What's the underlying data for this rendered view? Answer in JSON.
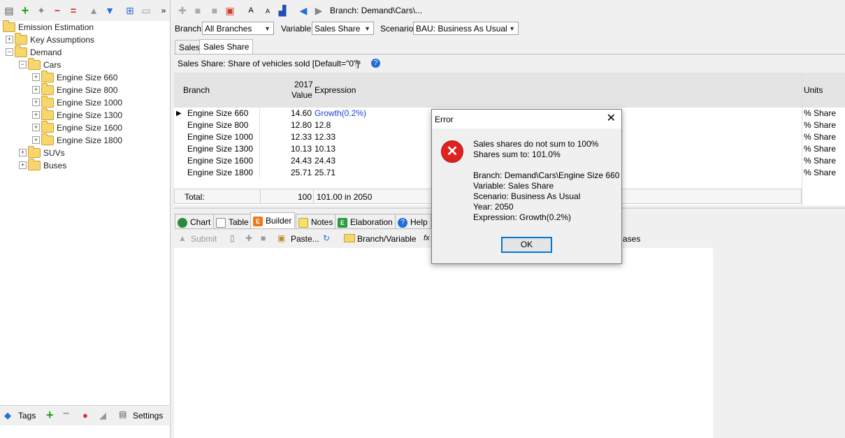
{
  "left_toolbar": {
    "icons": [
      "properties-icon",
      "add-icon",
      "add-many-icon",
      "delete-icon",
      "delete-many-icon",
      "move-up-icon",
      "move-down-icon",
      "tree-view-icon",
      "folder-icon",
      "more-icon"
    ],
    "more": "»"
  },
  "tree": [
    {
      "label": "Emission Estimation",
      "level": 0,
      "expander": ""
    },
    {
      "label": "Key Assumptions",
      "level": 1,
      "expander": "+"
    },
    {
      "label": "Demand",
      "level": 1,
      "expander": "−"
    },
    {
      "label": "Cars",
      "level": 2,
      "expander": "−"
    },
    {
      "label": "Engine Size 660",
      "level": 3,
      "expander": "+"
    },
    {
      "label": "Engine Size 800",
      "level": 3,
      "expander": "+"
    },
    {
      "label": "Engine Size 1000",
      "level": 3,
      "expander": "+"
    },
    {
      "label": "Engine Size 1300",
      "level": 3,
      "expander": "+"
    },
    {
      "label": "Engine Size 1600",
      "level": 3,
      "expander": "+"
    },
    {
      "label": "Engine Size 1800",
      "level": 3,
      "expander": "+"
    },
    {
      "label": "SUVs",
      "level": 2,
      "expander": "+"
    },
    {
      "label": "Buses",
      "level": 2,
      "expander": "+"
    }
  ],
  "left_bottom": {
    "tags": "Tags",
    "settings": "Settings"
  },
  "toolbar": {
    "breadcrumb": "Branch: Demand\\Cars\\...",
    "font_big": "A",
    "font_small": "A"
  },
  "filters": {
    "branch_label": "Branch:",
    "branch_value": "All Branches",
    "variable_label": "Variable:",
    "variable_value": "Sales Share",
    "scenario_label": "Scenario:",
    "scenario_value": "BAU: Business As Usual"
  },
  "tabs": [
    {
      "label": "Sales"
    },
    {
      "label": "Sales Share"
    }
  ],
  "description": "Sales Share: Share of vehicles sold [Default=\"0\"]",
  "grid": {
    "headers": {
      "branch": "Branch",
      "year": "2017",
      "value": "Value",
      "expression": "Expression",
      "units": "Units"
    },
    "rows": [
      {
        "branch": "Engine Size 660",
        "value": "14.60",
        "expression": "Growth(0.2%)",
        "units": "% Share"
      },
      {
        "branch": "Engine Size 800",
        "value": "12.80",
        "expression": "12.8",
        "units": "% Share"
      },
      {
        "branch": "Engine Size 1000",
        "value": "12.33",
        "expression": "12.33",
        "units": "% Share"
      },
      {
        "branch": "Engine Size 1300",
        "value": "10.13",
        "expression": "10.13",
        "units": "% Share"
      },
      {
        "branch": "Engine Size 1600",
        "value": "24.43",
        "expression": "24.43",
        "units": "% Share"
      },
      {
        "branch": "Engine Size 1800",
        "value": "25.71",
        "expression": "25.71",
        "units": "% Share"
      }
    ],
    "total": {
      "label": "Total:",
      "value": "100",
      "expression": "101.00 in 2050"
    }
  },
  "bottom_tabs": [
    {
      "label": "Chart"
    },
    {
      "label": "Table"
    },
    {
      "label": "Builder"
    },
    {
      "label": "Notes"
    },
    {
      "label": "Elaboration"
    },
    {
      "label": "Help"
    }
  ],
  "builder": {
    "submit": "Submit",
    "paste": "Paste...",
    "branch_variable": "Branch/Variable",
    "fx": "fx",
    "bases_fragment": "ases"
  },
  "dialog": {
    "title": "Error",
    "line1": "Sales shares do not sum to 100%",
    "line2": "Shares sum to: 101.0%",
    "branch": "Branch: Demand\\Cars\\Engine Size 660",
    "variable": "Variable: Sales Share",
    "scenario": "Scenario: Business As Usual",
    "year": "Year: 2050",
    "expression": "Expression: Growth(0.2%)",
    "ok": "OK"
  }
}
